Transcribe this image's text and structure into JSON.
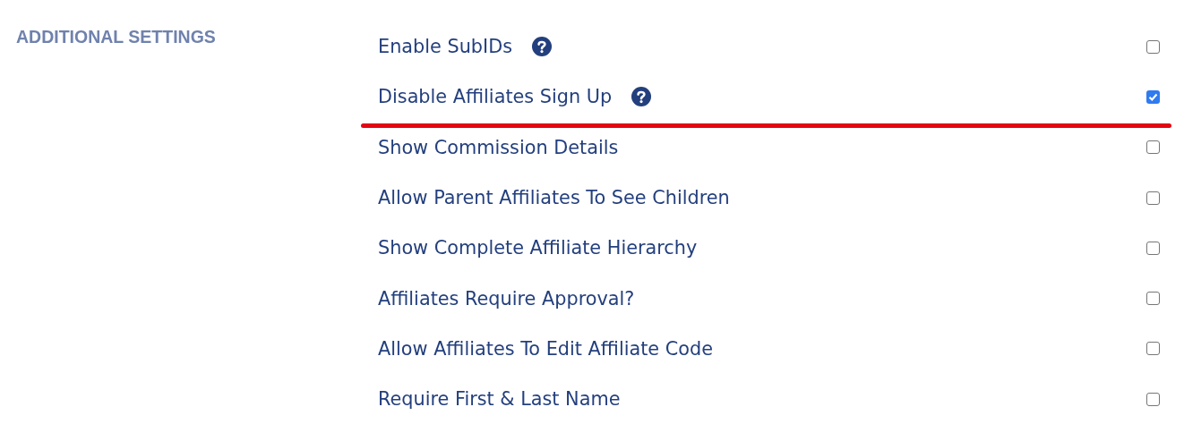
{
  "section_title": "ADDITIONAL SETTINGS",
  "settings": [
    {
      "label": "Enable SubIDs",
      "help": true,
      "checked": false,
      "underlined": false
    },
    {
      "label": "Disable Affiliates Sign Up",
      "help": true,
      "checked": true,
      "underlined": true
    },
    {
      "label": "Show Commission Details",
      "help": false,
      "checked": false,
      "underlined": false
    },
    {
      "label": "Allow Parent Affiliates To See Children",
      "help": false,
      "checked": false,
      "underlined": false
    },
    {
      "label": "Show Complete Affiliate Hierarchy",
      "help": false,
      "checked": false,
      "underlined": false
    },
    {
      "label": "Affiliates Require Approval?",
      "help": false,
      "checked": false,
      "underlined": false
    },
    {
      "label": "Allow Affiliates To Edit Affiliate Code",
      "help": false,
      "checked": false,
      "underlined": false
    },
    {
      "label": "Require First & Last Name",
      "help": false,
      "checked": false,
      "underlined": false
    }
  ]
}
